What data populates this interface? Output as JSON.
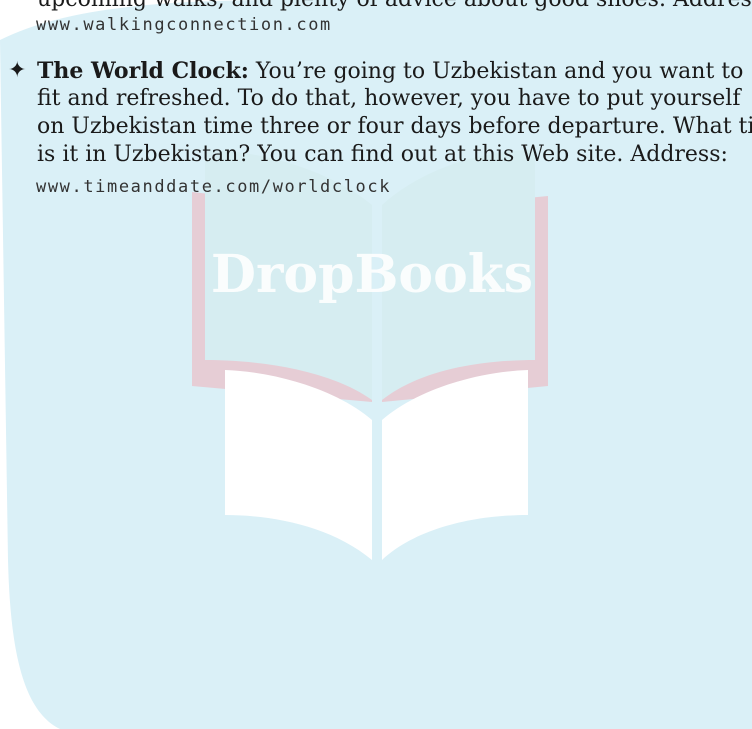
{
  "watermark": {
    "brand_text": "DropBooks",
    "bg_color": "#daf0f7",
    "book_color": "#d9ecef",
    "page_color": "#ffffff",
    "spine_color": "#e7c7cf"
  },
  "entries": [
    {
      "text_lines": [
        "upcoming walks, and plenty of advice about good shoes. Address:"
      ],
      "url": "www.walkingconnection.com"
    },
    {
      "bullet_icon": "four-pointed-star-bullet",
      "bullet_glyph": "✦",
      "title": "The World Clock:",
      "text_lines": [
        " You’re going to Uzbekistan and you want to",
        "fit and refreshed. To do that, however, you have to put yourself",
        "on Uzbekistan time three or four days before departure. What time",
        "is it in Uzbekistan? You can find out at this Web site. Address:"
      ],
      "url": "www.timeanddate.com/worldclock"
    }
  ]
}
